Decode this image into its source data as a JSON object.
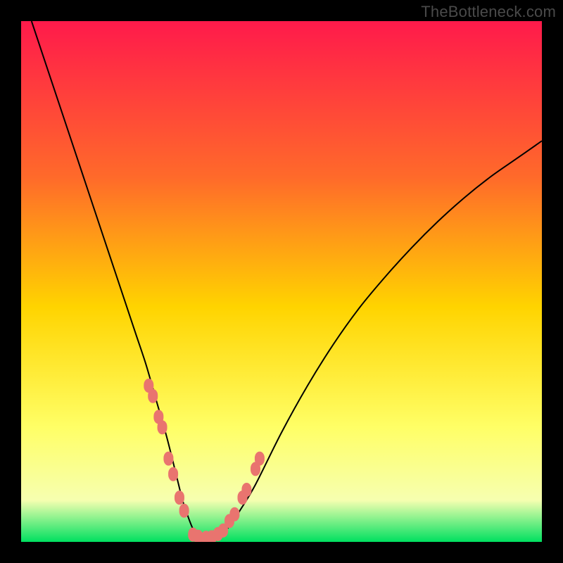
{
  "watermark": "TheBottleneck.com",
  "colors": {
    "frame": "#000000",
    "grad_top": "#ff1a4b",
    "grad_mid1": "#ff6a2a",
    "grad_mid2": "#ffd400",
    "grad_low1": "#ffff66",
    "grad_low2": "#f6ffb0",
    "grad_bottom": "#00e060",
    "curve": "#000000",
    "marker_fill": "#e9746f",
    "marker_stroke": "#cc5a55"
  },
  "chart_data": {
    "type": "line",
    "title": "",
    "xlabel": "",
    "ylabel": "",
    "xlim": [
      0,
      100
    ],
    "ylim": [
      0,
      100
    ],
    "grid": false,
    "legend": false,
    "series": [
      {
        "name": "bottleneck-curve",
        "x": [
          2,
          4,
          6,
          8,
          10,
          12,
          14,
          16,
          18,
          20,
          22,
          24,
          26,
          28,
          30,
          31,
          32,
          33,
          34,
          35,
          36,
          38,
          40,
          42,
          45,
          50,
          55,
          60,
          65,
          70,
          75,
          80,
          85,
          90,
          95,
          100
        ],
        "y": [
          100,
          94,
          88,
          82,
          76,
          70,
          64,
          58,
          52,
          46,
          40,
          34,
          27,
          20,
          12,
          8,
          5,
          2.5,
          1.2,
          0.6,
          0.6,
          1.2,
          3,
          6,
          11,
          21,
          30,
          38,
          45,
          51,
          56.5,
          61.5,
          66,
          70,
          73.5,
          77
        ]
      }
    ],
    "markers": {
      "name": "highlight-points",
      "x": [
        24.5,
        25.3,
        26.4,
        27.1,
        28.3,
        29.2,
        30.4,
        31.3,
        33.0,
        34.0,
        35.5,
        36.6,
        37.8,
        38.8,
        40.0,
        41.0,
        42.5,
        43.3,
        45.0,
        45.8
      ],
      "y": [
        30,
        28,
        24,
        22,
        16,
        13,
        8.5,
        6,
        1.4,
        1.0,
        0.8,
        0.9,
        1.5,
        2.2,
        4,
        5.3,
        8.5,
        10,
        14,
        16
      ]
    },
    "annotations": []
  }
}
